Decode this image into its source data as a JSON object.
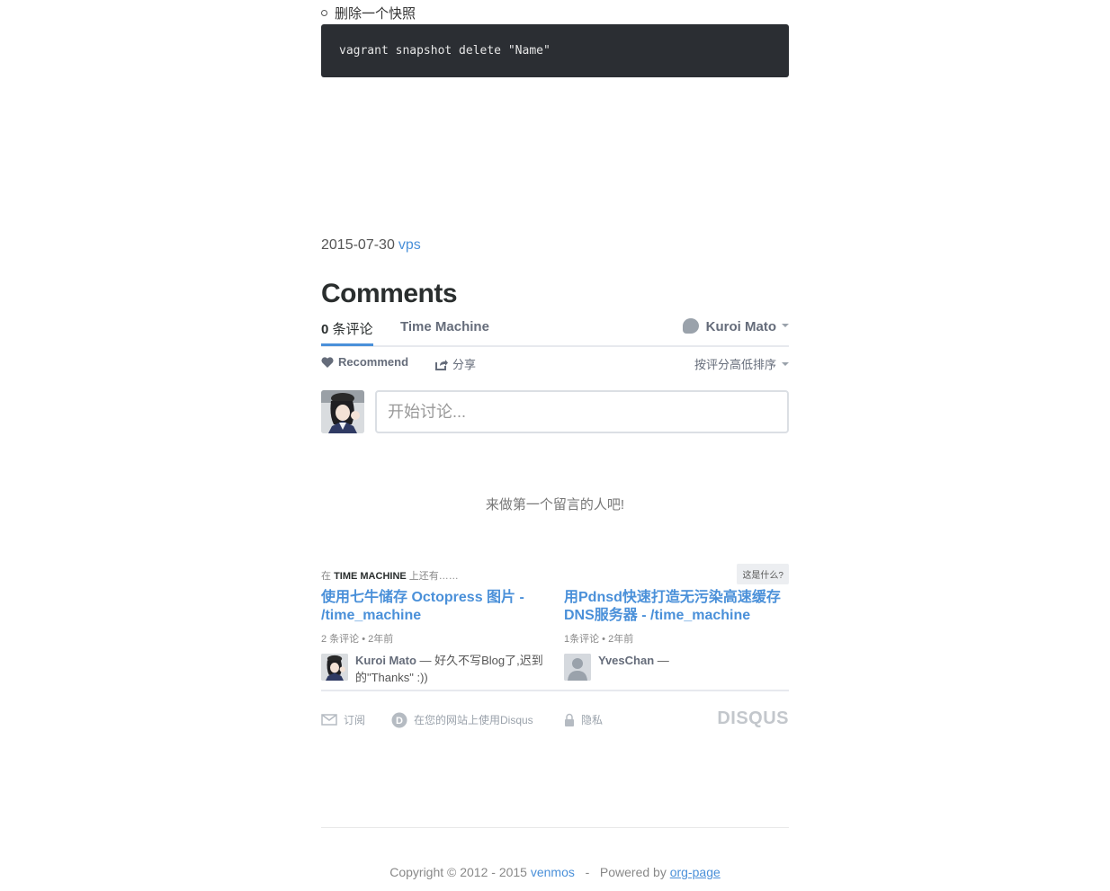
{
  "article": {
    "bullet_text": "删除一个快照",
    "code": "vagrant snapshot delete \"Name\"",
    "date": "2015-07-30",
    "tag": "vps"
  },
  "comments": {
    "title": "Comments",
    "count_num": "0",
    "count_label": "条评论",
    "site_tab": "Time Machine",
    "user_name": "Kuroi Mato",
    "recommend_label": "Recommend",
    "share_label": "分享",
    "sort_label": "按评分高低排序",
    "input_placeholder": "开始讨论...",
    "empty_text": "来做第一个留言的人吧!"
  },
  "also_on": {
    "prefix": "在",
    "site": "TIME MACHINE",
    "suffix": "上还有……",
    "whatis_label": "这是什么?",
    "items": [
      {
        "title": "使用七牛储存 Octopress 图片 - /time_machine",
        "meta": "2 条评论 • 2年前",
        "commenter": "Kuroi Mato",
        "excerpt": "— 好久不写Blog了,迟到的\"Thanks\" :))"
      },
      {
        "title": "用Pdnsd快速打造无污染高速缓存DNS服务器 - /time_machine",
        "meta": "1条评论 • 2年前",
        "commenter": "YvesChan",
        "excerpt": "—"
      }
    ]
  },
  "disqus_footer": {
    "subscribe": "订阅",
    "use_disqus": "在您的网站上使用Disqus",
    "privacy": "隐私",
    "logo": "DISQUS"
  },
  "footer": {
    "copyright_prefix": "Copyright © 2012 - 2015",
    "author": "venmos",
    "separator": "-",
    "powered_prefix": "Powered by",
    "engine": "org-page"
  },
  "colors": {
    "link": "#4a90d9",
    "code_bg": "#2b2e33",
    "muted": "#656c7a"
  }
}
